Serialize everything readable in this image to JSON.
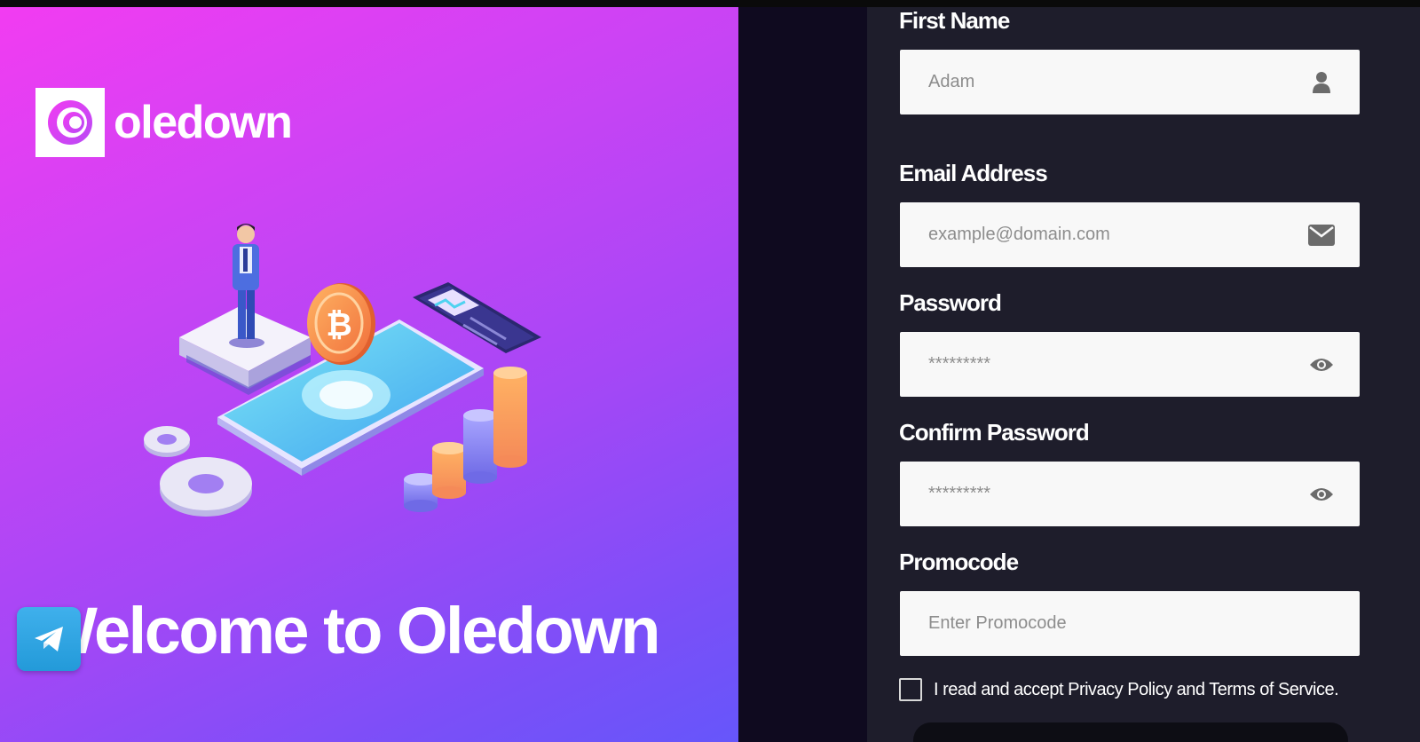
{
  "brand": {
    "name": "oledown",
    "welcome": "Welcome to Oledown"
  },
  "colors": {
    "hero_start": "#f23cf2",
    "hero_end": "#6656fa",
    "form_bg": "#1e1d2b",
    "divider_bg": "#0f0a1f",
    "telegram": "#2aa3e0"
  },
  "icons": {
    "logo": "oledown-logo",
    "first_name": "user-icon",
    "email": "envelope-icon",
    "password": "eye-icon",
    "confirm_password": "eye-icon",
    "telegram": "telegram-icon",
    "illustration": "crypto-isometric-illustration"
  },
  "form": {
    "first_name": {
      "label": "First Name",
      "placeholder": "Adam"
    },
    "email": {
      "label": "Email Address",
      "placeholder": "example@domain.com"
    },
    "password": {
      "label": "Password",
      "placeholder": "*********"
    },
    "confirm_password": {
      "label": "Confirm Password",
      "placeholder": "*********"
    },
    "promocode": {
      "label": "Promocode",
      "placeholder": "Enter Promocode"
    },
    "terms": "I read and accept Privacy Policy and Terms of Service."
  }
}
